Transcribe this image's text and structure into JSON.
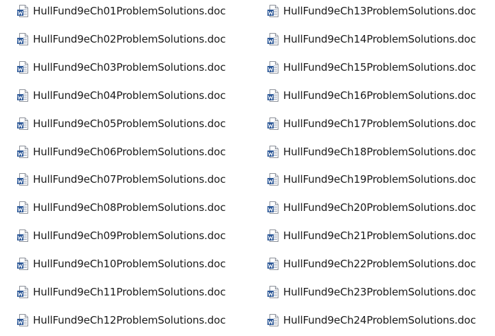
{
  "icon": "word-document-icon",
  "colors": {
    "icon_blue": "#2b5797",
    "icon_paper": "#ffffff",
    "icon_border": "#8a8f98",
    "text": "#1a1a1a"
  },
  "columns": [
    {
      "files": [
        "HullFund9eCh01ProblemSolutions.doc",
        "HullFund9eCh02ProblemSolutions.doc",
        "HullFund9eCh03ProblemSolutions.doc",
        "HullFund9eCh04ProblemSolutions.doc",
        "HullFund9eCh05ProblemSolutions.doc",
        "HullFund9eCh06ProblemSolutions.doc",
        "HullFund9eCh07ProblemSolutions.doc",
        "HullFund9eCh08ProblemSolutions.doc",
        "HullFund9eCh09ProblemSolutions.doc",
        "HullFund9eCh10ProblemSolutions.doc",
        "HullFund9eCh11ProblemSolutions.doc",
        "HullFund9eCh12ProblemSolutions.doc"
      ]
    },
    {
      "files": [
        "HullFund9eCh13ProblemSolutions.doc",
        "HullFund9eCh14ProblemSolutions.doc",
        "HullFund9eCh15ProblemSolutions.doc",
        "HullFund9eCh16ProblemSolutions.doc",
        "HullFund9eCh17ProblemSolutions.doc",
        "HullFund9eCh18ProblemSolutions.doc",
        "HullFund9eCh19ProblemSolutions.doc",
        "HullFund9eCh20ProblemSolutions.doc",
        "HullFund9eCh21ProblemSolutions.doc",
        "HullFund9eCh22ProblemSolutions.doc",
        "HullFund9eCh23ProblemSolutions.doc",
        "HullFund9eCh24ProblemSolutions.doc"
      ]
    }
  ]
}
